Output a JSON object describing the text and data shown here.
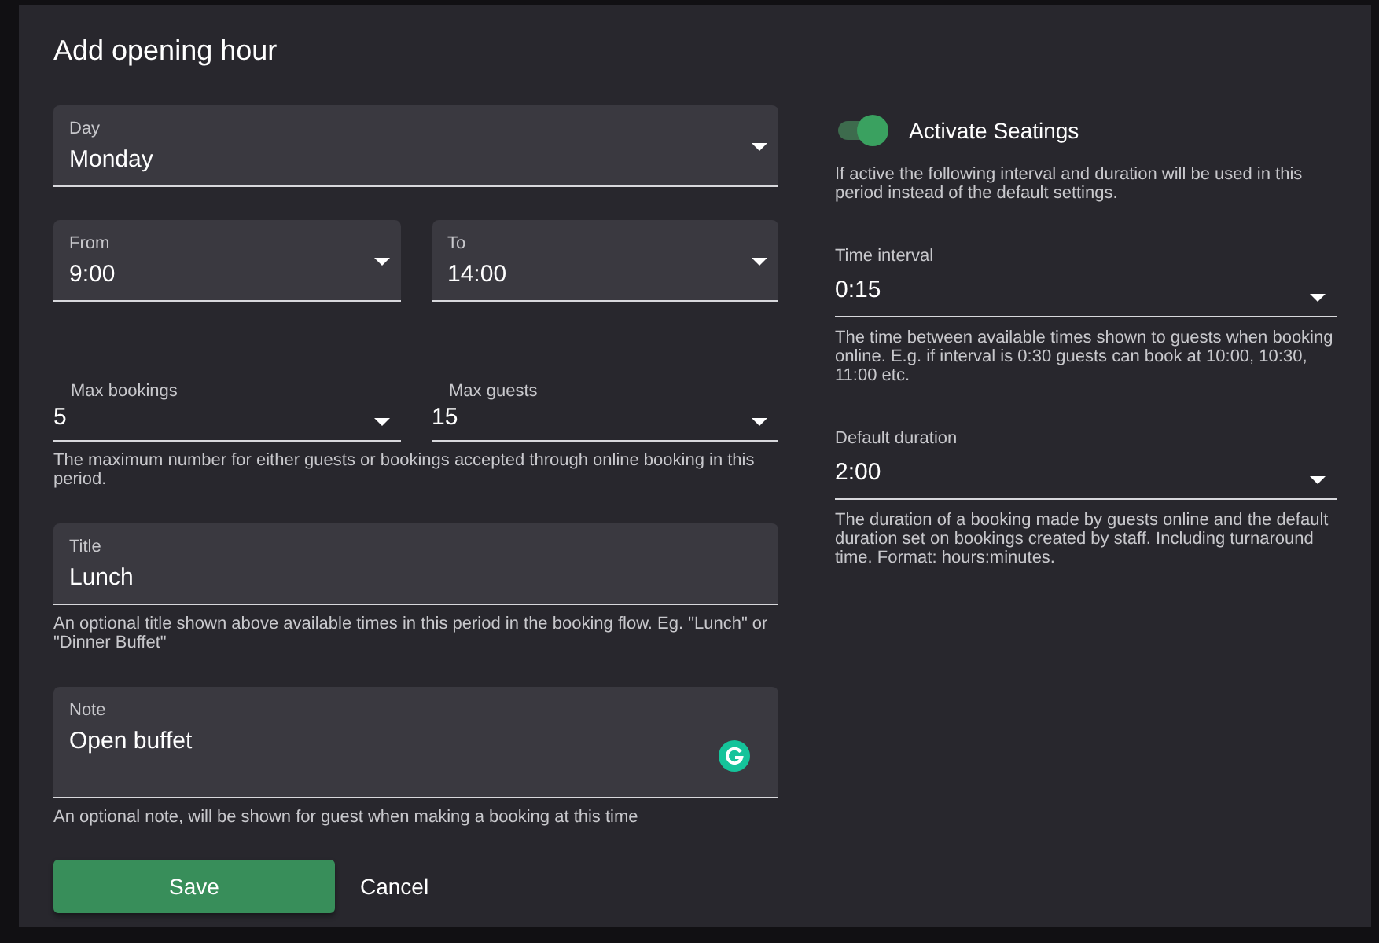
{
  "dialog": {
    "title": "Add opening hour"
  },
  "day": {
    "label": "Day",
    "value": "Monday"
  },
  "time_range": [
    {
      "label": "From",
      "value": "9:00"
    },
    {
      "label": "To",
      "value": "14:00"
    }
  ],
  "limits": [
    {
      "label": "Max bookings",
      "value": "5"
    },
    {
      "label": "Max guests",
      "value": "15"
    }
  ],
  "limits_hint": "The maximum number for either guests or bookings accepted through online booking in this period.",
  "title_field": {
    "label": "Title",
    "value": "Lunch",
    "hint": "An optional title shown above available times in this period in the booking flow. Eg. \"Lunch\" or \"Dinner Buffet\""
  },
  "note_field": {
    "label": "Note",
    "value": "Open buffet",
    "hint": "An optional note, will be shown for guest when making a booking at this time"
  },
  "buttons": [
    {
      "label": "Save",
      "kind": "primary"
    },
    {
      "label": "Cancel",
      "kind": "text"
    }
  ],
  "seatings": {
    "label": "Activate Seatings",
    "on": true,
    "hint": "If active the following interval and duration will be used in this period instead of the default settings."
  },
  "seating_fields": [
    {
      "label": "Time interval",
      "value": "0:15",
      "hint": "The time between available times shown to guests when booking online. E.g. if interval is 0:30 guests can book at 10:00, 10:30, 11:00 etc."
    },
    {
      "label": "Default duration",
      "value": "2:00",
      "hint": "The duration of a booking made by guests online and the default duration set on bookings created by staff. Including turnaround time. Format: hours:minutes."
    }
  ]
}
